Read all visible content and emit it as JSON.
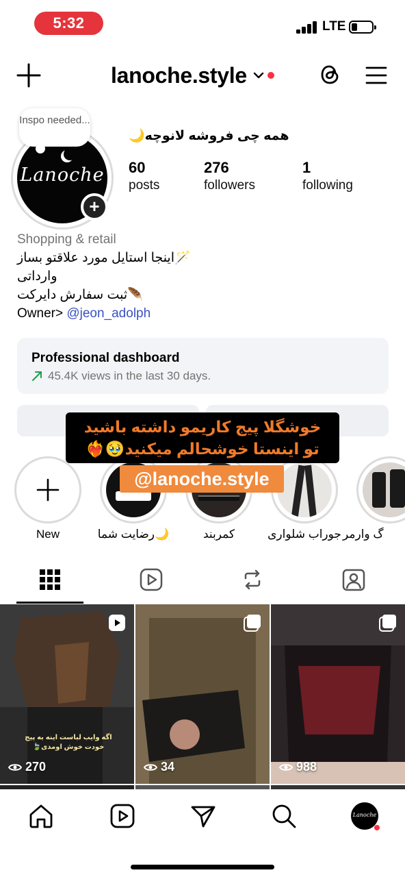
{
  "status_bar": {
    "time": "5:32",
    "network": "LTE"
  },
  "header": {
    "username": "lanoche.style"
  },
  "profile": {
    "note": "Inspo needed...",
    "display_name": "همه چی فروشه لانوچه🌙",
    "stats": [
      {
        "number": "60",
        "label": "posts"
      },
      {
        "number": "276",
        "label": "followers"
      },
      {
        "number": "1",
        "label": "following"
      }
    ],
    "category": "Shopping & retail",
    "bio_lines": [
      "اینجا استایل مورد علاقتو بساز🪄",
      "وارداتی",
      "ثبت سفارش دایرکت🪶"
    ],
    "owner_prefix": "Owner> ",
    "owner_mention": "@jeon_adolph"
  },
  "dashboard": {
    "title": "Professional dashboard",
    "subtitle": "45.4K views in the last 30 days.",
    "trend_color": "#1a9e4b"
  },
  "overlay": {
    "line1": "خوشگلا پیج کاریمو داشته باشید",
    "line2": "تو اینستا خوشحالم میکنید🥹❤️‍🔥",
    "handle": "@lanoche.style"
  },
  "highlights": [
    {
      "label": "New",
      "icon": "plus-icon"
    },
    {
      "label": "رضایت شما🌙"
    },
    {
      "label": "کمربند"
    },
    {
      "label": "جوراب شلواری"
    },
    {
      "label": "گ وارمر"
    }
  ],
  "tabs": [
    {
      "name": "grid",
      "icon": "grid-icon",
      "active": true
    },
    {
      "name": "reels",
      "icon": "reels-icon"
    },
    {
      "name": "reposts",
      "icon": "repost-icon"
    },
    {
      "name": "tagged",
      "icon": "tagged-icon"
    }
  ],
  "posts": [
    {
      "views": "270",
      "type": "reel",
      "caption": "اگه وایب لباست اینه به پیج خودت خوش اومدی🍃"
    },
    {
      "views": "34",
      "type": "carousel"
    },
    {
      "views": "988",
      "type": "carousel"
    }
  ],
  "bottom_nav": [
    {
      "name": "home",
      "icon": "home-icon"
    },
    {
      "name": "reels",
      "icon": "reels-icon"
    },
    {
      "name": "messages",
      "icon": "send-icon"
    },
    {
      "name": "search",
      "icon": "search-icon"
    },
    {
      "name": "profile",
      "icon": "avatar"
    }
  ],
  "avatar_text": "Lanoche",
  "colors": {
    "status_pill": "#e5343b",
    "mention": "#3a51c2",
    "overlay_text": "#f07a2a",
    "overlay_handle_bg": "#f08a3c",
    "notification_dot": "#ff3040"
  }
}
